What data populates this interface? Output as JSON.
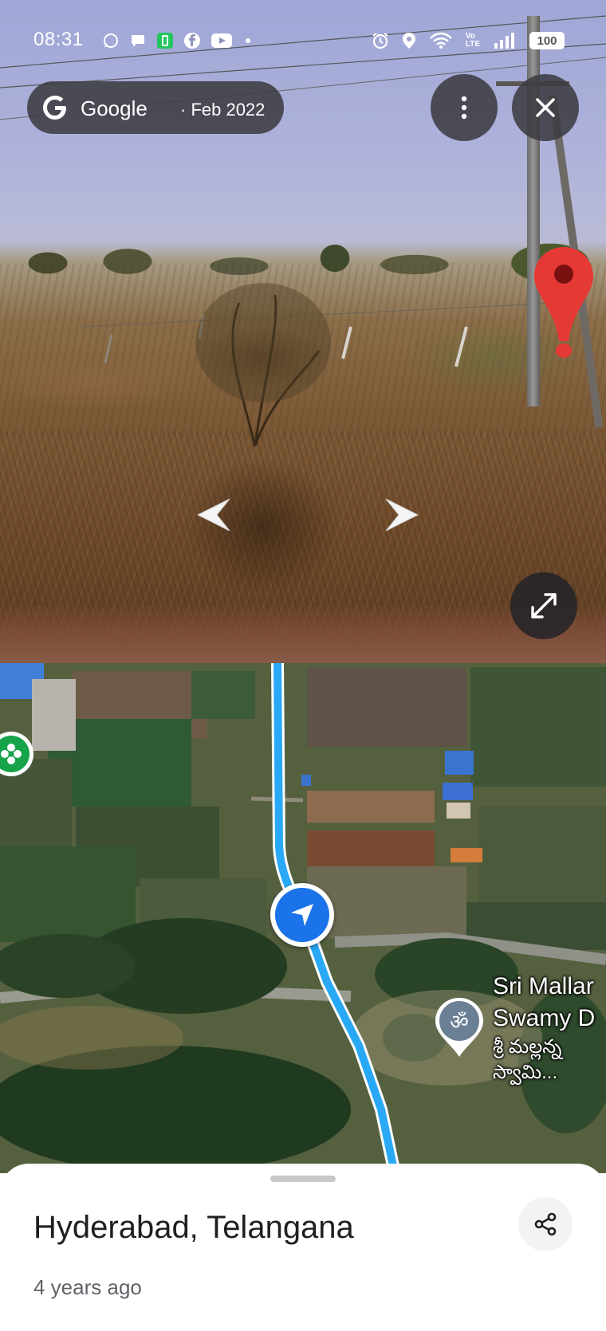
{
  "status_bar": {
    "time": "08:31",
    "battery": "100",
    "notification_icons": [
      "whatsapp-icon",
      "chat-icon",
      "battery-app-icon",
      "facebook-icon",
      "youtube-icon",
      "dot-icon"
    ],
    "system_icons": [
      "alarm-icon",
      "location-icon",
      "wifi-icon",
      "volte-icon",
      "signal-icon"
    ]
  },
  "street_view": {
    "brand": "Google",
    "capture_date": "· Feb 2022",
    "more_icon": "more-vert-icon",
    "close_icon": "close-icon",
    "expand_icon": "expand-icon",
    "pin_color": "#e53935"
  },
  "map": {
    "poi": {
      "name_line1": "Sri Mallar",
      "name_line2": "Swamy D",
      "telugu_line1": "శ్రీ మల్లన్న",
      "telugu_line2": "స్వామి..."
    },
    "route_color": "#29a8f5",
    "nav_marker_color": "#1a73e8"
  },
  "bottom_sheet": {
    "title": "Hyderabad, Telangana",
    "subtitle": "4 years ago",
    "share_icon": "share-icon"
  }
}
